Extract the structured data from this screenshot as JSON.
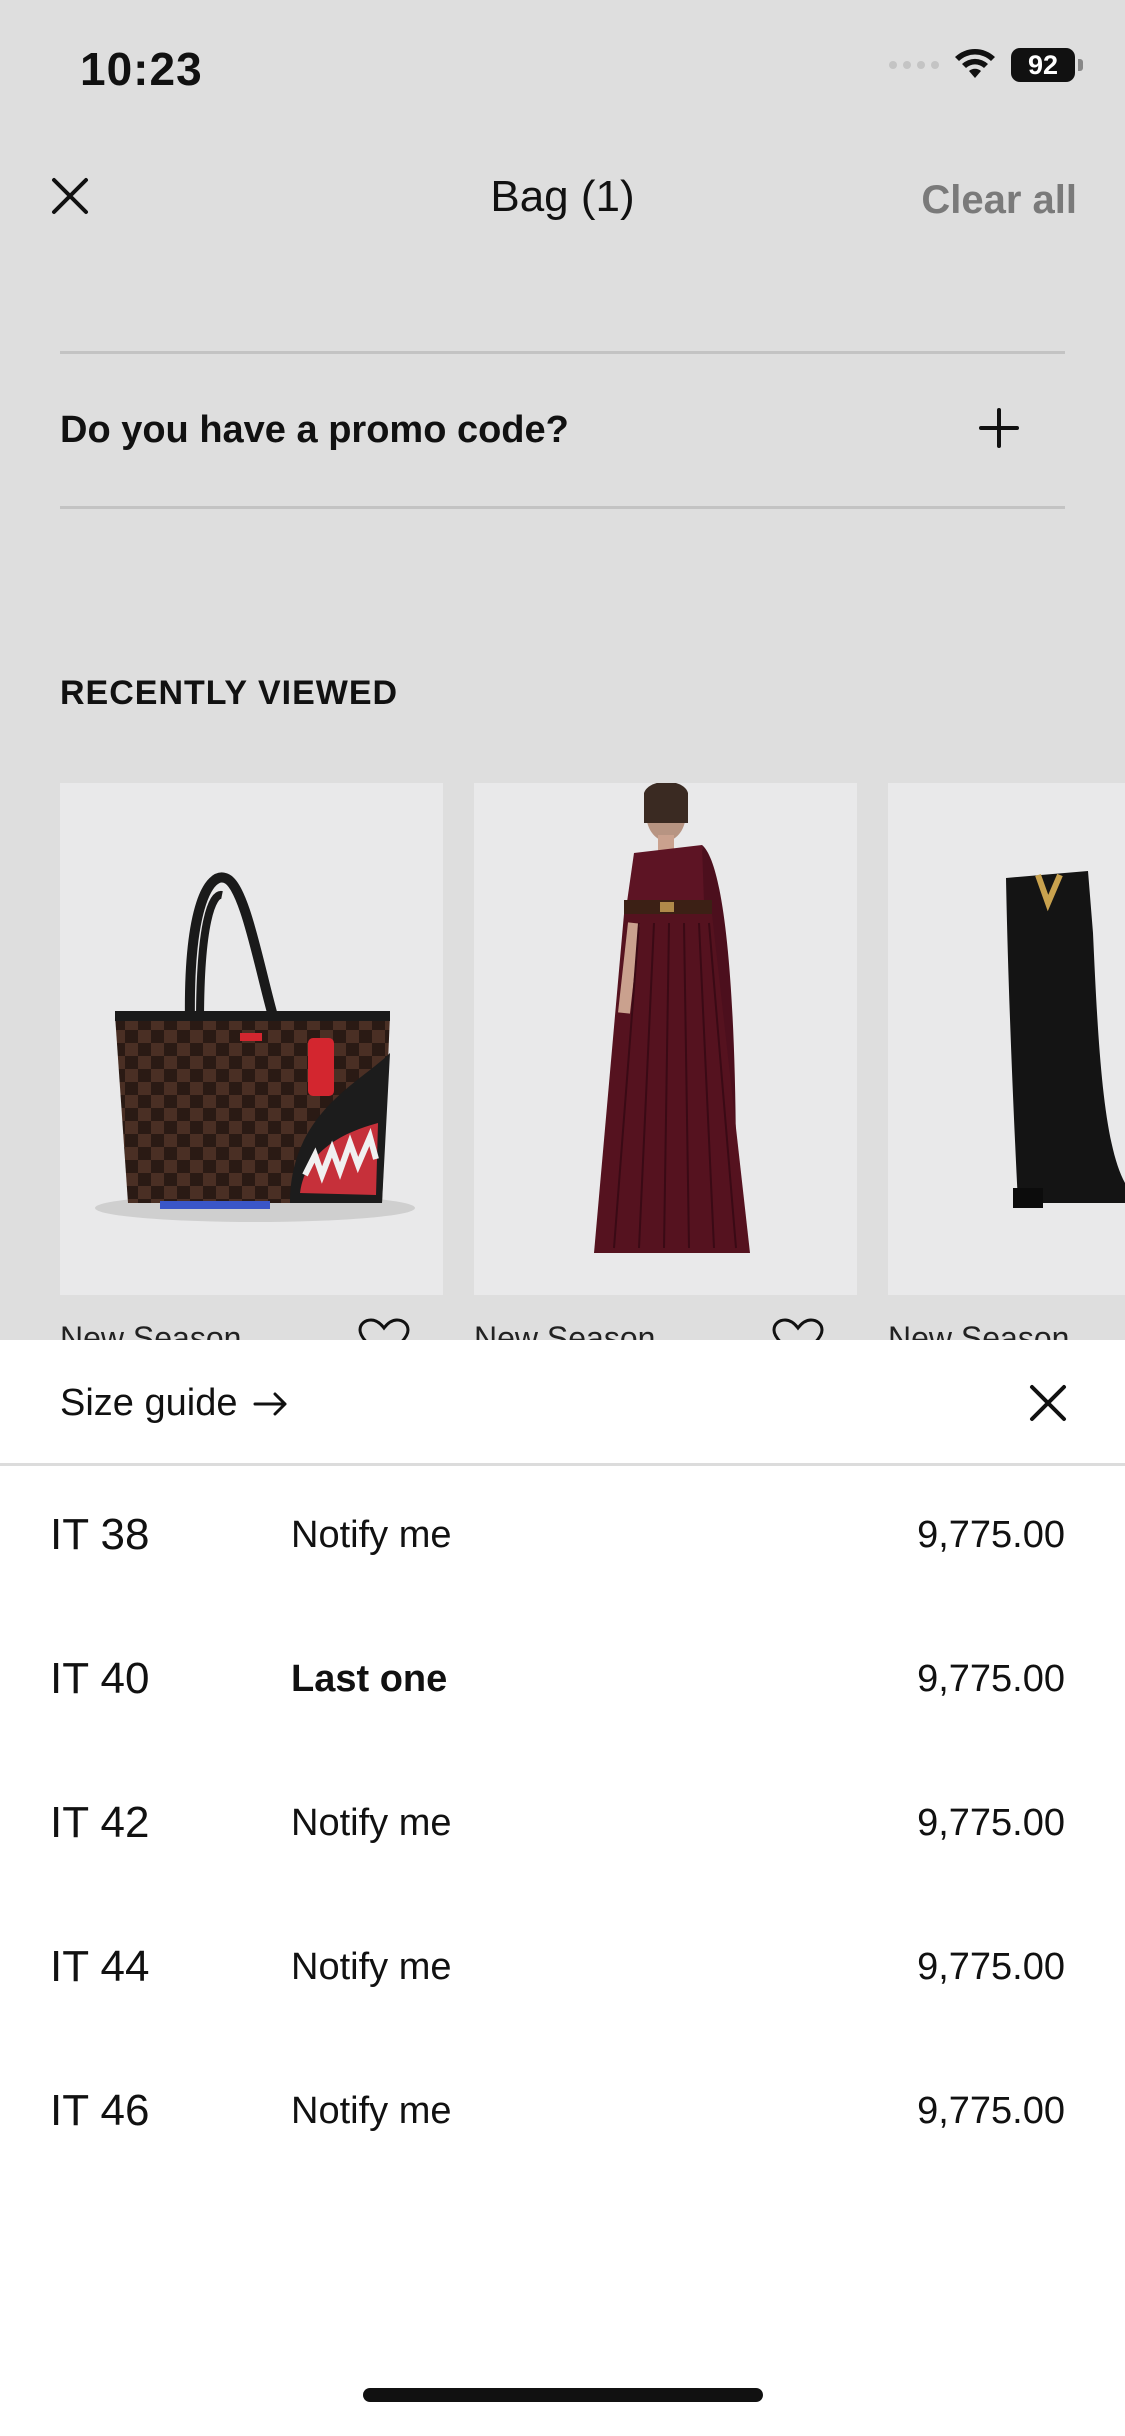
{
  "status_bar": {
    "time": "10:23",
    "battery": "92"
  },
  "header": {
    "title": "Bag (1)",
    "clear_all": "Clear all"
  },
  "promo": {
    "label": "Do you have a promo code?"
  },
  "recently_viewed": {
    "title": "RECENTLY VIEWED",
    "items": [
      {
        "label": "New Season"
      },
      {
        "label": "New Season"
      },
      {
        "label": "New Season"
      }
    ]
  },
  "size_sheet": {
    "size_guide": "Size guide",
    "rows": [
      {
        "size": "IT 38",
        "status": "Notify me",
        "price": "9,775.00"
      },
      {
        "size": "IT 40",
        "status": "Last one",
        "price": "9,775.00"
      },
      {
        "size": "IT 42",
        "status": "Notify me",
        "price": "9,775.00"
      },
      {
        "size": "IT 44",
        "status": "Notify me",
        "price": "9,775.00"
      },
      {
        "size": "IT 46",
        "status": "Notify me",
        "price": "9,775.00"
      }
    ]
  },
  "icons": {
    "close": "close-icon",
    "plus": "plus-icon",
    "heart": "heart-icon",
    "arrow": "arrow-right-icon",
    "wifi": "wifi-icon",
    "battery": "battery-icon"
  }
}
